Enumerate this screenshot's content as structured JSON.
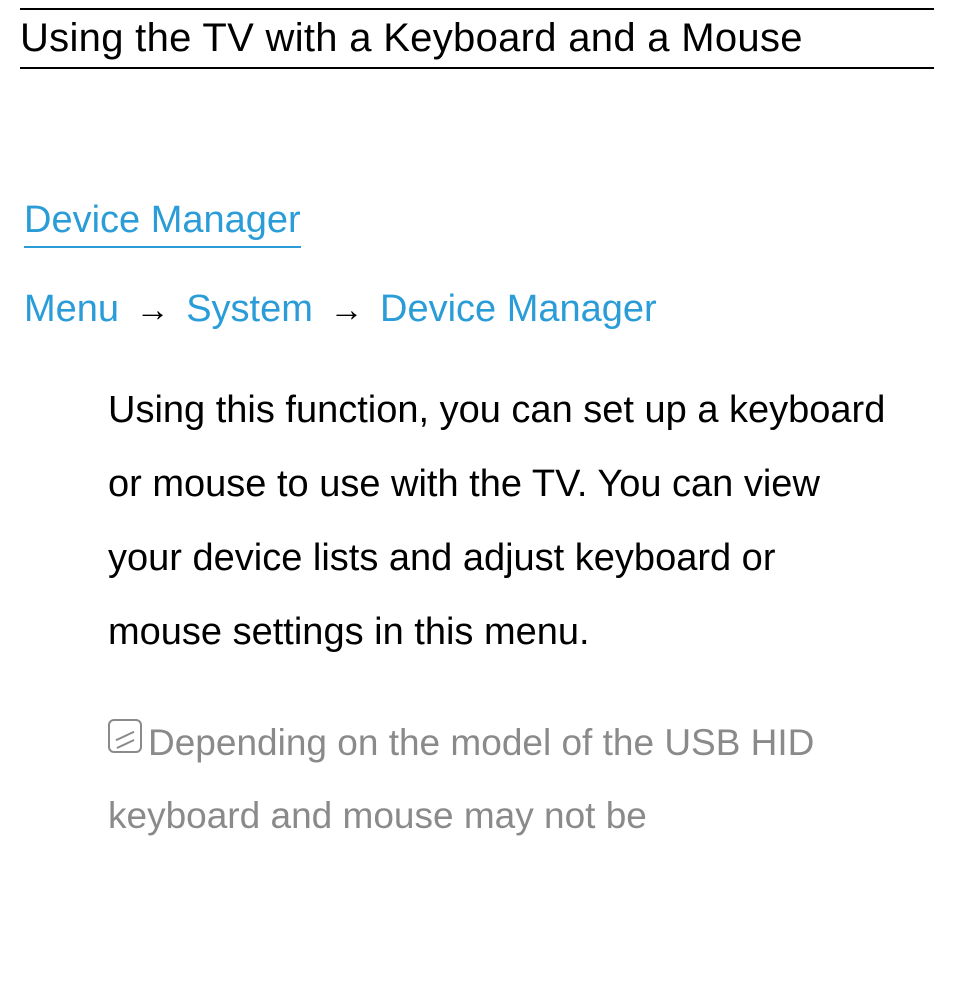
{
  "title": "Using the TV with a Keyboard and a Mouse",
  "section_heading": "Device Manager",
  "breadcrumb": {
    "items": [
      "Menu",
      "System",
      "Device Manager"
    ],
    "separator": "→"
  },
  "body_paragraph": "Using this function, you can set up a keyboard or mouse to use with the TV. You can view your device lists and adjust keyboard or mouse settings in this menu.",
  "note_icon_name": "note-icon",
  "note_text": "Depending on the model of the USB HID keyboard and mouse may not be",
  "colors": {
    "link_blue": "#2a9cd8",
    "note_gray": "#8a8a8a"
  }
}
